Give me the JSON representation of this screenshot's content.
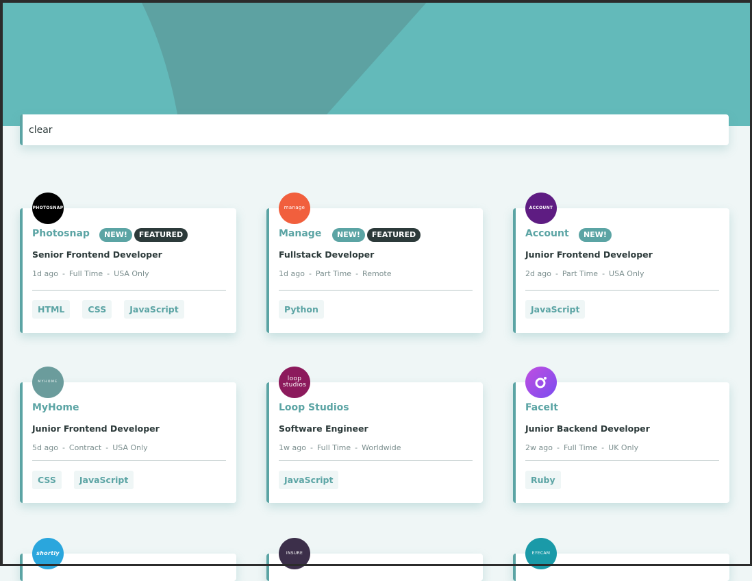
{
  "search": {
    "value": "clear"
  },
  "colors": {
    "primary": "#5ba4a4",
    "header_bg": "#63baba",
    "page_bg": "#eff6f6",
    "dark": "#2c3a3a"
  },
  "jobs": [
    {
      "company": "Photosnap",
      "logo_text": "PHOTOSNAP",
      "logo_color": "#000000",
      "new": "NEW!",
      "featured": "FEATURED",
      "position": "Senior Frontend Developer",
      "posted": "1d ago",
      "contract": "Full Time",
      "location": "USA Only",
      "tags": [
        "HTML",
        "CSS",
        "JavaScript"
      ]
    },
    {
      "company": "Manage",
      "logo_text": "manage",
      "logo_color": "#f15f3d",
      "new": "NEW!",
      "featured": "FEATURED",
      "position": "Fullstack Developer",
      "posted": "1d ago",
      "contract": "Part Time",
      "location": "Remote",
      "tags": [
        "Python"
      ]
    },
    {
      "company": "Account",
      "logo_text": "ACCOUNT",
      "logo_color": "#5e1c82",
      "new": "NEW!",
      "featured": "",
      "position": "Junior Frontend Developer",
      "posted": "2d ago",
      "contract": "Part Time",
      "location": "USA Only",
      "tags": [
        "JavaScript"
      ]
    },
    {
      "company": "MyHome",
      "logo_text": "MYHOME",
      "logo_color": "#6b9c9c",
      "new": "",
      "featured": "",
      "position": "Junior Frontend Developer",
      "posted": "5d ago",
      "contract": "Contract",
      "location": "USA Only",
      "tags": [
        "CSS",
        "JavaScript"
      ]
    },
    {
      "company": "Loop Studios",
      "logo_text": "loop studios",
      "logo_color": "#8c1a5c",
      "new": "",
      "featured": "",
      "position": "Software Engineer",
      "posted": "1w ago",
      "contract": "Full Time",
      "location": "Worldwide",
      "tags": [
        "JavaScript"
      ]
    },
    {
      "company": "FaceIt",
      "logo_text": "",
      "logo_color": "#9a4fe0",
      "new": "",
      "featured": "",
      "position": "Junior Backend Developer",
      "posted": "2w ago",
      "contract": "Full Time",
      "location": "UK Only",
      "tags": [
        "Ruby"
      ]
    },
    {
      "company": "",
      "logo_text": "shortly",
      "logo_color": "#2aa6dd",
      "new": "",
      "featured": "",
      "position": "",
      "posted": "",
      "contract": "",
      "location": "",
      "tags": []
    },
    {
      "company": "",
      "logo_text": "INSURE",
      "logo_color": "#3c2f4a",
      "new": "",
      "featured": "",
      "position": "",
      "posted": "",
      "contract": "",
      "location": "",
      "tags": []
    },
    {
      "company": "",
      "logo_text": "EYECAM",
      "logo_color": "#1a9aa8",
      "new": "",
      "featured": "",
      "position": "",
      "posted": "",
      "contract": "",
      "location": "",
      "tags": []
    }
  ]
}
